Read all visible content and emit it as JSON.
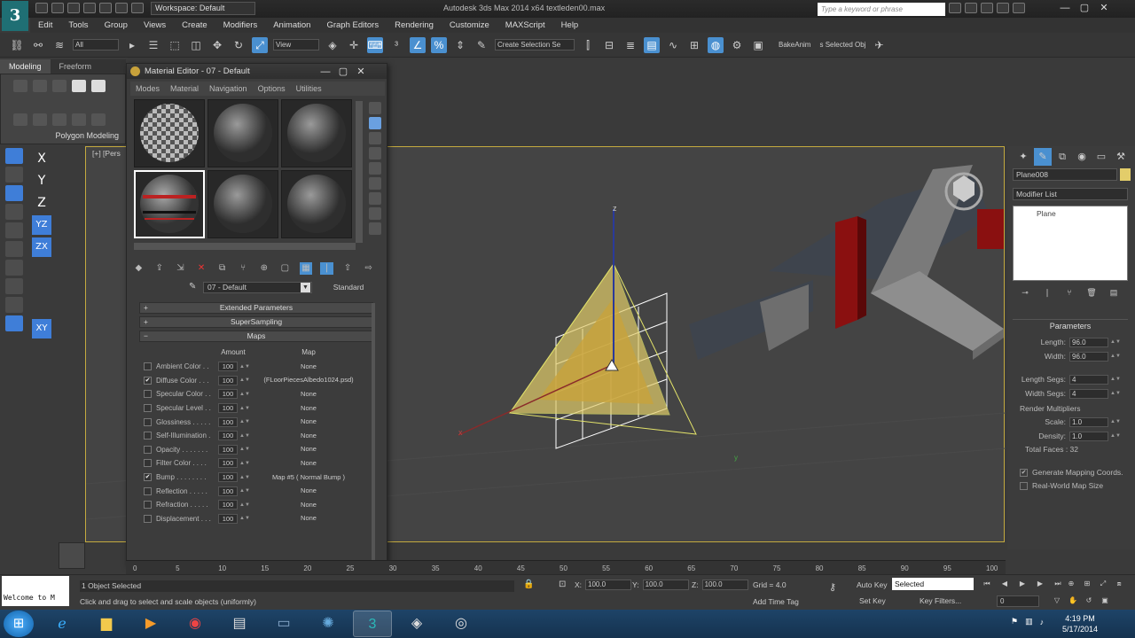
{
  "titlebar": {
    "workspace": "Workspace: Default",
    "app_title": "Autodesk 3ds Max 2014 x64     textleden00.max",
    "search_placeholder": "Type a keyword or phrase",
    "minimize": "—",
    "maximize": "▢",
    "close": "✕"
  },
  "menu": [
    "Edit",
    "Tools",
    "Group",
    "Views",
    "Create",
    "Modifiers",
    "Animation",
    "Graph Editors",
    "Rendering",
    "Customize",
    "MAXScript",
    "Help"
  ],
  "toolbar": {
    "filter": "All",
    "ref_coord": "View",
    "named_selection": "Create Selection Se",
    "bake_anim": "BakeAnim",
    "selected_obj": "s Selected Obj"
  },
  "ribbon": {
    "tabs": [
      "Modeling",
      "Freeform"
    ],
    "panel_label": "Polygon Modeling"
  },
  "axes": [
    "X",
    "Y",
    "Z",
    "YZ",
    "ZX",
    "XY"
  ],
  "viewport": {
    "label": "[+] [Pers",
    "axis_z": "z",
    "axis_x": "x",
    "axis_y": "y"
  },
  "material_editor": {
    "title": "Material Editor - 07 - Default",
    "menu": [
      "Modes",
      "Material",
      "Navigation",
      "Options",
      "Utilities"
    ],
    "material_name": "07 - Default",
    "material_type": "Standard",
    "rollouts": {
      "extended": "Extended Parameters",
      "supersampling": "SuperSampling",
      "maps": "Maps"
    },
    "maps_headers": {
      "amount": "Amount",
      "map": "Map"
    },
    "maps": [
      {
        "label": "Ambient Color . .",
        "checked": false,
        "amount": "100",
        "map": "None"
      },
      {
        "label": "Diffuse Color . . .",
        "checked": true,
        "amount": "100",
        "map": "(FLoorPiecesAlbedo1024.psd)"
      },
      {
        "label": "Specular Color . .",
        "checked": false,
        "amount": "100",
        "map": "None"
      },
      {
        "label": "Specular Level . .",
        "checked": false,
        "amount": "100",
        "map": "None"
      },
      {
        "label": "Glossiness . . . . .",
        "checked": false,
        "amount": "100",
        "map": "None"
      },
      {
        "label": "Self-Illumination .",
        "checked": false,
        "amount": "100",
        "map": "None"
      },
      {
        "label": "Opacity . . . . . . .",
        "checked": false,
        "amount": "100",
        "map": "None"
      },
      {
        "label": "Filter Color . . . .",
        "checked": false,
        "amount": "100",
        "map": "None"
      },
      {
        "label": "Bump . . . . . . . .",
        "checked": true,
        "amount": "100",
        "map": "Map #5  ( Normal Bump )"
      },
      {
        "label": "Reflection . . . . .",
        "checked": false,
        "amount": "100",
        "map": "None"
      },
      {
        "label": "Refraction . . . . .",
        "checked": false,
        "amount": "100",
        "map": "None"
      },
      {
        "label": "Displacement . . .",
        "checked": false,
        "amount": "100",
        "map": "None"
      }
    ]
  },
  "command_panel": {
    "object_name": "Plane008",
    "modifier_list": "Modifier List",
    "stack_item": "Plane",
    "params_title": "Parameters",
    "length_label": "Length:",
    "length": "96.0",
    "width_label": "Width:",
    "width": "96.0",
    "length_segs_label": "Length Segs:",
    "length_segs": "4",
    "width_segs_label": "Width Segs:",
    "width_segs": "4",
    "render_mult": "Render Multipliers",
    "scale_label": "Scale:",
    "scale": "1.0",
    "density_label": "Density:",
    "density": "1.0",
    "total_faces": "Total Faces : 32",
    "gen_mapping": "Generate Mapping Coords.",
    "real_world": "Real-World Map Size"
  },
  "timeline_ticks": [
    "0",
    "5",
    "10",
    "15",
    "20",
    "25",
    "30",
    "35",
    "40",
    "45",
    "50",
    "55",
    "60",
    "65",
    "70",
    "75",
    "80",
    "85",
    "90",
    "95",
    "100"
  ],
  "status": {
    "welcome": "Welcome to M",
    "selected_count": "1 Object Selected",
    "prompt": "Click and drag to select and scale objects (uniformly)",
    "x_label": "X:",
    "x_val": "100.0",
    "y_label": "Y:",
    "y_val": "100.0",
    "z_label": "Z:",
    "z_val": "100.0",
    "grid": "Grid = 4.0",
    "add_time_tag": "Add Time Tag",
    "auto_key": "Auto Key",
    "set_key": "Set Key",
    "selected": "Selected",
    "key_filters": "Key Filters...",
    "frame": "0"
  },
  "taskbar": {
    "time": "4:19 PM",
    "date": "5/17/2014"
  },
  "colors": {
    "accent": "#3f7ed8",
    "selection_yellow": "#e3cd6a",
    "viewport_border": "#c4aa3f"
  }
}
